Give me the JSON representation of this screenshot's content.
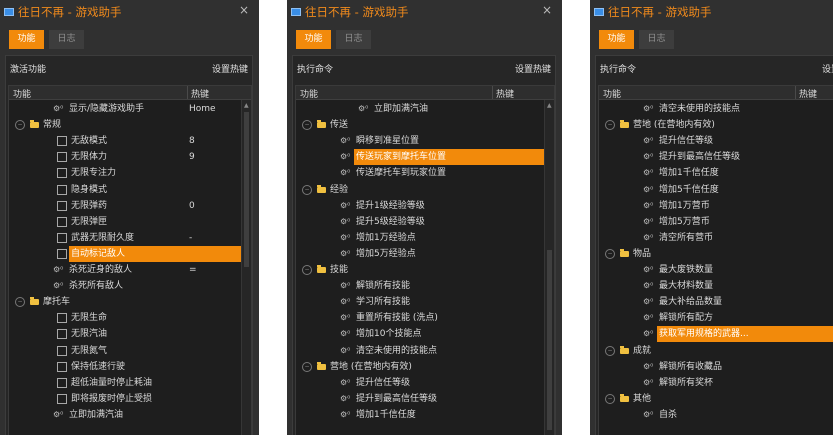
{
  "app": {
    "title": "往日不再 - 游戏助手",
    "close": "×",
    "tab_functions": "功能",
    "tab_log": "日志",
    "accent": "#f28a0b"
  },
  "windows": [
    {
      "header_left": "激活功能",
      "header_right": "设置热键",
      "col_name": "功能",
      "col_hotkey": "热键",
      "rows": [
        {
          "type": "gear",
          "level": 1,
          "label": "显示/隐藏游戏助手",
          "hotkey": "Home"
        },
        {
          "type": "folder",
          "level": 0,
          "label": "常规"
        },
        {
          "type": "check",
          "level": 1,
          "label": "无敌模式",
          "hotkey": "8"
        },
        {
          "type": "check",
          "level": 1,
          "label": "无限体力",
          "hotkey": "9"
        },
        {
          "type": "check",
          "level": 1,
          "label": "无限专注力"
        },
        {
          "type": "check",
          "level": 1,
          "label": "隐身模式"
        },
        {
          "type": "check",
          "level": 1,
          "label": "无限弹药",
          "hotkey": "0"
        },
        {
          "type": "check",
          "level": 1,
          "label": "无限弹匣"
        },
        {
          "type": "check",
          "level": 1,
          "label": "武器无限耐久度",
          "hotkey": "-"
        },
        {
          "type": "check",
          "level": 1,
          "label": "自动标记敌人",
          "selected": true
        },
        {
          "type": "gear",
          "level": 1,
          "label": "杀死近身的敌人",
          "hotkey": "="
        },
        {
          "type": "gear",
          "level": 1,
          "label": "杀死所有敌人"
        },
        {
          "type": "folder",
          "level": 0,
          "label": "摩托车"
        },
        {
          "type": "check",
          "level": 1,
          "label": "无限生命"
        },
        {
          "type": "check",
          "level": 1,
          "label": "无限汽油"
        },
        {
          "type": "check",
          "level": 1,
          "label": "无限氮气"
        },
        {
          "type": "check",
          "level": 1,
          "label": "保持低速行驶"
        },
        {
          "type": "check",
          "level": 1,
          "label": "超低油量时停止耗油"
        },
        {
          "type": "check",
          "level": 1,
          "label": "即将报废时停止受损"
        },
        {
          "type": "gear",
          "level": 1,
          "label": "立即加满汽油"
        }
      ]
    },
    {
      "header_left": "执行命令",
      "header_right": "设置热键",
      "col_name": "功能",
      "col_hotkey": "热键",
      "rows": [
        {
          "type": "gear",
          "level": 2,
          "label": "立即加满汽油"
        },
        {
          "type": "folder",
          "level": 0,
          "label": "传送"
        },
        {
          "type": "gear",
          "level": 1,
          "label": "瞬移到准星位置"
        },
        {
          "type": "gear",
          "level": 1,
          "label": "传送玩家到摩托车位置",
          "selected": true
        },
        {
          "type": "gear",
          "level": 1,
          "label": "传送摩托车到玩家位置"
        },
        {
          "type": "folder",
          "level": 0,
          "label": "经验"
        },
        {
          "type": "gear",
          "level": 1,
          "label": "提升1级经验等级"
        },
        {
          "type": "gear",
          "level": 1,
          "label": "提升5级经验等级"
        },
        {
          "type": "gear",
          "level": 1,
          "label": "增加1万经验点"
        },
        {
          "type": "gear",
          "level": 1,
          "label": "增加5万经验点"
        },
        {
          "type": "folder",
          "level": 0,
          "label": "技能"
        },
        {
          "type": "gear",
          "level": 1,
          "label": "解锁所有技能"
        },
        {
          "type": "gear",
          "level": 1,
          "label": "学习所有技能"
        },
        {
          "type": "gear",
          "level": 1,
          "label": "重置所有技能 (洗点)"
        },
        {
          "type": "gear",
          "level": 1,
          "label": "增加10个技能点"
        },
        {
          "type": "gear",
          "level": 1,
          "label": "清空未使用的技能点"
        },
        {
          "type": "folder",
          "level": 0,
          "label": "营地 (在营地内有效)"
        },
        {
          "type": "gear",
          "level": 1,
          "label": "提升信任等级"
        },
        {
          "type": "gear",
          "level": 1,
          "label": "提升到最高信任等级"
        },
        {
          "type": "gear",
          "level": 1,
          "label": "增加1千信任度"
        }
      ]
    },
    {
      "header_left": "执行命令",
      "header_right": "设置热键",
      "col_name": "功能",
      "col_hotkey": "热键",
      "rows": [
        {
          "type": "gear",
          "level": 1,
          "label": "清空未使用的技能点"
        },
        {
          "type": "folder",
          "level": 0,
          "label": "营地 (在营地内有效)"
        },
        {
          "type": "gear",
          "level": 1,
          "label": "提升信任等级"
        },
        {
          "type": "gear",
          "level": 1,
          "label": "提升到最高信任等级"
        },
        {
          "type": "gear",
          "level": 1,
          "label": "增加1千信任度"
        },
        {
          "type": "gear",
          "level": 1,
          "label": "增加5千信任度"
        },
        {
          "type": "gear",
          "level": 1,
          "label": "增加1万营币"
        },
        {
          "type": "gear",
          "level": 1,
          "label": "增加5万营币"
        },
        {
          "type": "gear",
          "level": 1,
          "label": "清空所有营币"
        },
        {
          "type": "folder",
          "level": 0,
          "label": "物品"
        },
        {
          "type": "gear",
          "level": 1,
          "label": "最大废铁数量"
        },
        {
          "type": "gear",
          "level": 1,
          "label": "最大材料数量"
        },
        {
          "type": "gear",
          "level": 1,
          "label": "最大补给品数量"
        },
        {
          "type": "gear",
          "level": 1,
          "label": "解锁所有配方"
        },
        {
          "type": "gear",
          "level": 1,
          "label": "获取军用规格的武器...",
          "selected": true
        },
        {
          "type": "folder",
          "level": 0,
          "label": "成就"
        },
        {
          "type": "gear",
          "level": 1,
          "label": "解锁所有收藏品"
        },
        {
          "type": "gear",
          "level": 1,
          "label": "解锁所有奖杯"
        },
        {
          "type": "folder",
          "level": 0,
          "label": "其他"
        },
        {
          "type": "gear",
          "level": 1,
          "label": "自杀"
        }
      ]
    }
  ]
}
